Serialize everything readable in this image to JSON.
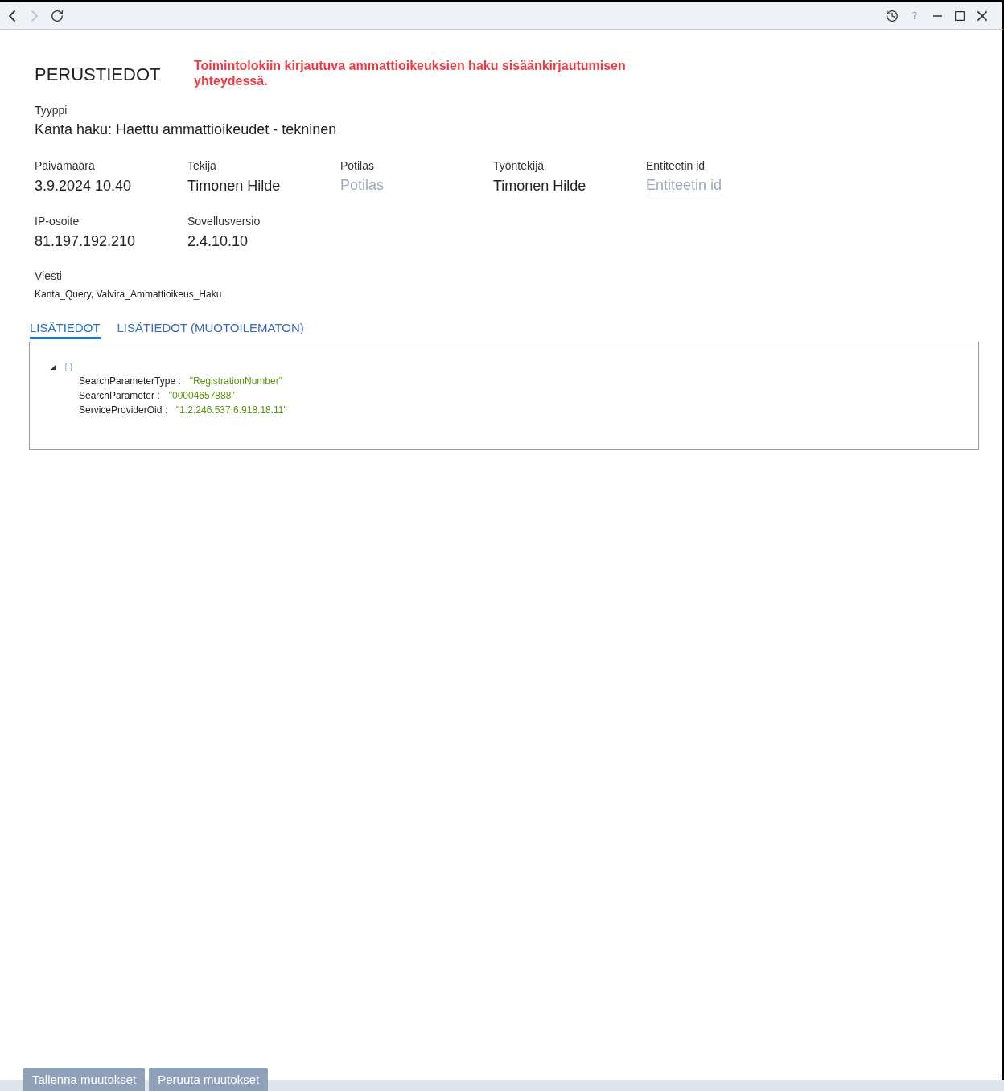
{
  "titlebar": {
    "nav": [
      {
        "kind": "back",
        "disabled": false
      },
      {
        "kind": "forward",
        "disabled": true
      },
      {
        "kind": "refresh",
        "disabled": false
      }
    ],
    "tools": [
      {
        "kind": "history",
        "disabled": false
      },
      {
        "kind": "help",
        "label": "?",
        "disabled": true
      }
    ],
    "window_controls": [
      {
        "kind": "minimize"
      },
      {
        "kind": "maximize"
      },
      {
        "kind": "close"
      }
    ]
  },
  "header": {
    "title": "PERUSTIEDOT",
    "note": "Toimintolokiin kirjautuva ammattioikeuksien haku sisäänkirjautumisen yhteydessä."
  },
  "type": {
    "label": "Tyyppi",
    "value": "Kanta haku: Haettu ammattioikeudet - tekninen"
  },
  "field_rows": [
    [
      {
        "label": "Päivämäärä",
        "kind": "text",
        "value": "3.9.2024 10.40"
      },
      {
        "label": "Tekijä",
        "kind": "text",
        "value": "Timonen Hilde"
      },
      {
        "label": "Potilas",
        "kind": "input",
        "placeholder": "Potilas"
      },
      {
        "label": "Työntekijä",
        "kind": "text",
        "value": "Timonen Hilde"
      },
      {
        "label": "Entiteetin id",
        "kind": "underlined-input",
        "placeholder": "Entiteetin id"
      }
    ],
    [
      {
        "label": "IP-osoite",
        "kind": "text",
        "value": "81.197.192.210"
      },
      {
        "label": "Sovellusversio",
        "kind": "text",
        "value": "2.4.10.10"
      }
    ]
  ],
  "message": {
    "label": "Viesti",
    "value": "Kanta_Query, Valvira_Ammattioikeus_Haku"
  },
  "tabs": [
    {
      "label": "LISÄTIEDOT",
      "selected": true
    },
    {
      "label": "LISÄTIEDOT (MUOTOILEMATON)",
      "selected": false
    }
  ],
  "tree": {
    "label": "{ }",
    "expanded": true,
    "children": [
      {
        "key": "SearchParameterType :",
        "value": "\"RegistrationNumber\""
      },
      {
        "key": "SearchParameter :",
        "value": "\"00004657888\""
      },
      {
        "key": "ServiceProviderOid :",
        "value": "\"1.2.246.537.6.918.18.11\""
      }
    ]
  },
  "buttons": [
    {
      "label": "Tallenna muutokset",
      "disabled": true
    },
    {
      "label": "Peruuta muutokset",
      "disabled": true
    }
  ]
}
